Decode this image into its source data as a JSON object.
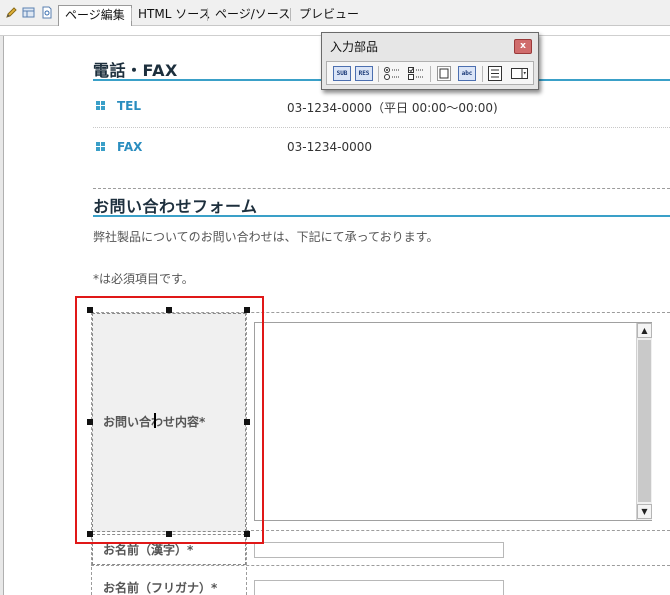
{
  "tabs": [
    {
      "label": "ページ編集",
      "active": true
    },
    {
      "label": "HTML ソース",
      "active": false
    },
    {
      "label": "ページ/ソース",
      "active": false
    },
    {
      "label": "プレビュー",
      "active": false
    }
  ],
  "toolbar_icons": [
    "pencil-icon",
    "layout-icon",
    "preview-page-icon"
  ],
  "palette": {
    "title": "入力部品",
    "close": "x",
    "buttons": [
      {
        "name": "submit-button-tool",
        "text": "SUB"
      },
      {
        "name": "reset-button-tool",
        "text": "RES"
      },
      {
        "name": "radio-button-tool",
        "text": ""
      },
      {
        "name": "checkbox-tool",
        "text": ""
      },
      {
        "name": "text-field-tool",
        "text": ""
      },
      {
        "name": "text-area-tool",
        "text": "abc"
      },
      {
        "name": "list-box-tool",
        "text": ""
      },
      {
        "name": "dropdown-tool",
        "text": ""
      }
    ]
  },
  "contact": {
    "title": "電話・FAX",
    "rows": [
      {
        "label": "TEL",
        "value": "03-1234-0000（平日 00:00〜00:00)"
      },
      {
        "label": "FAX",
        "value": "03-1234-0000"
      }
    ]
  },
  "inquiry": {
    "title": "お問い合わせフォーム",
    "description": "弊社製品についてのお問い合わせは、下記にて承っております。",
    "required_note": "*は必須項目です。",
    "fields": [
      {
        "label": "お問い合わせ内容*"
      },
      {
        "label": "お名前（漢字）*"
      },
      {
        "label": "お名前（フリガナ）*"
      }
    ]
  },
  "colors": {
    "accent": "#3aa0c8",
    "selection": "#e01818",
    "link": "#2a8dbf"
  }
}
